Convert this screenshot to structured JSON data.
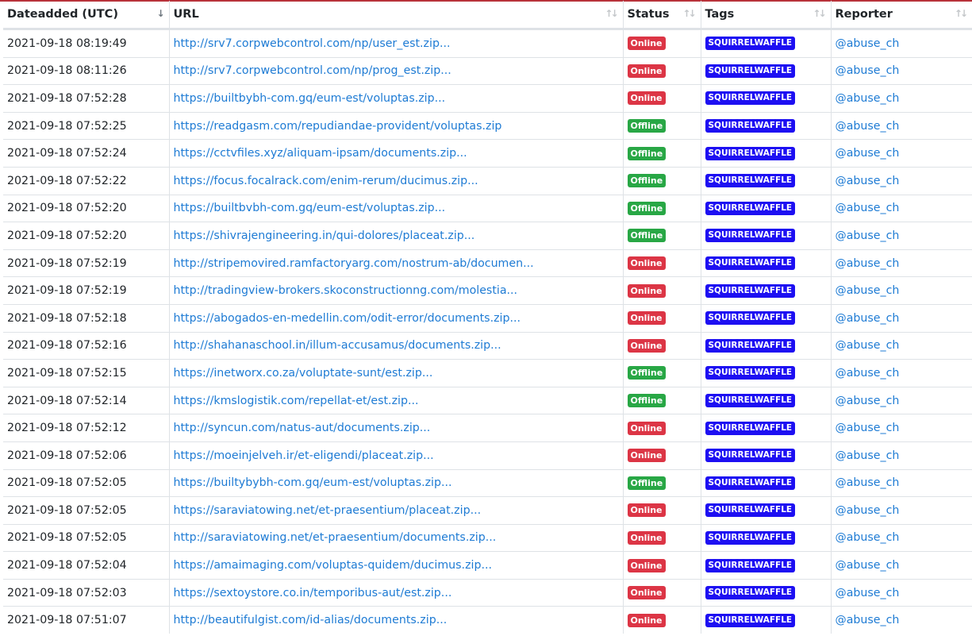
{
  "columns": {
    "date": "Dateadded (UTC)",
    "url": "URL",
    "status": "Status",
    "tags": "Tags",
    "reporter": "Reporter"
  },
  "colors": {
    "online": "#dc3545",
    "offline": "#28a745",
    "tag": "#1d0ff2",
    "link": "#1e7bd4"
  },
  "rows": [
    {
      "date": "2021-09-18 08:19:49",
      "url": "http://srv7.corpwebcontrol.com/np/user_est.zip...",
      "status": "Online",
      "tag": "SQUIRRELWAFFLE",
      "reporter": "@abuse_ch"
    },
    {
      "date": "2021-09-18 08:11:26",
      "url": "http://srv7.corpwebcontrol.com/np/prog_est.zip...",
      "status": "Online",
      "tag": "SQUIRRELWAFFLE",
      "reporter": "@abuse_ch"
    },
    {
      "date": "2021-09-18 07:52:28",
      "url": "https://builtbybh-com.gq/eum-est/voluptas.zip...",
      "status": "Online",
      "tag": "SQUIRRELWAFFLE",
      "reporter": "@abuse_ch"
    },
    {
      "date": "2021-09-18 07:52:25",
      "url": "https://readgasm.com/repudiandae-provident/voluptas.zip",
      "status": "Offline",
      "tag": "SQUIRRELWAFFLE",
      "reporter": "@abuse_ch"
    },
    {
      "date": "2021-09-18 07:52:24",
      "url": "https://cctvfiles.xyz/aliquam-ipsam/documents.zip...",
      "status": "Offline",
      "tag": "SQUIRRELWAFFLE",
      "reporter": "@abuse_ch"
    },
    {
      "date": "2021-09-18 07:52:22",
      "url": "https://focus.focalrack.com/enim-rerum/ducimus.zip...",
      "status": "Offline",
      "tag": "SQUIRRELWAFFLE",
      "reporter": "@abuse_ch"
    },
    {
      "date": "2021-09-18 07:52:20",
      "url": "https://builtbvbh-com.gq/eum-est/voluptas.zip...",
      "status": "Offline",
      "tag": "SQUIRRELWAFFLE",
      "reporter": "@abuse_ch"
    },
    {
      "date": "2021-09-18 07:52:20",
      "url": "https://shivrajengineering.in/qui-dolores/placeat.zip...",
      "status": "Offline",
      "tag": "SQUIRRELWAFFLE",
      "reporter": "@abuse_ch"
    },
    {
      "date": "2021-09-18 07:52:19",
      "url": "http://stripemovired.ramfactoryarg.com/nostrum-ab/documen...",
      "status": "Online",
      "tag": "SQUIRRELWAFFLE",
      "reporter": "@abuse_ch"
    },
    {
      "date": "2021-09-18 07:52:19",
      "url": "http://tradingview-brokers.skoconstructionng.com/molestia...",
      "status": "Online",
      "tag": "SQUIRRELWAFFLE",
      "reporter": "@abuse_ch"
    },
    {
      "date": "2021-09-18 07:52:18",
      "url": "https://abogados-en-medellin.com/odit-error/documents.zip...",
      "status": "Online",
      "tag": "SQUIRRELWAFFLE",
      "reporter": "@abuse_ch"
    },
    {
      "date": "2021-09-18 07:52:16",
      "url": "http://shahanaschool.in/illum-accusamus/documents.zip...",
      "status": "Online",
      "tag": "SQUIRRELWAFFLE",
      "reporter": "@abuse_ch"
    },
    {
      "date": "2021-09-18 07:52:15",
      "url": "https://inetworx.co.za/voluptate-sunt/est.zip...",
      "status": "Offline",
      "tag": "SQUIRRELWAFFLE",
      "reporter": "@abuse_ch"
    },
    {
      "date": "2021-09-18 07:52:14",
      "url": "https://kmslogistik.com/repellat-et/est.zip...",
      "status": "Offline",
      "tag": "SQUIRRELWAFFLE",
      "reporter": "@abuse_ch"
    },
    {
      "date": "2021-09-18 07:52:12",
      "url": "http://syncun.com/natus-aut/documents.zip...",
      "status": "Online",
      "tag": "SQUIRRELWAFFLE",
      "reporter": "@abuse_ch"
    },
    {
      "date": "2021-09-18 07:52:06",
      "url": "https://moeinjelveh.ir/et-eligendi/placeat.zip...",
      "status": "Online",
      "tag": "SQUIRRELWAFFLE",
      "reporter": "@abuse_ch"
    },
    {
      "date": "2021-09-18 07:52:05",
      "url": "https://builtybybh-com.gq/eum-est/voluptas.zip...",
      "status": "Offline",
      "tag": "SQUIRRELWAFFLE",
      "reporter": "@abuse_ch"
    },
    {
      "date": "2021-09-18 07:52:05",
      "url": "https://saraviatowing.net/et-praesentium/placeat.zip...",
      "status": "Online",
      "tag": "SQUIRRELWAFFLE",
      "reporter": "@abuse_ch"
    },
    {
      "date": "2021-09-18 07:52:05",
      "url": "http://saraviatowing.net/et-praesentium/documents.zip...",
      "status": "Online",
      "tag": "SQUIRRELWAFFLE",
      "reporter": "@abuse_ch"
    },
    {
      "date": "2021-09-18 07:52:04",
      "url": "https://amaimaging.com/voluptas-quidem/ducimus.zip...",
      "status": "Online",
      "tag": "SQUIRRELWAFFLE",
      "reporter": "@abuse_ch"
    },
    {
      "date": "2021-09-18 07:52:03",
      "url": "https://sextoystore.co.in/temporibus-aut/est.zip...",
      "status": "Online",
      "tag": "SQUIRRELWAFFLE",
      "reporter": "@abuse_ch"
    },
    {
      "date": "2021-09-18 07:51:07",
      "url": "http://beautifulgist.com/id-alias/documents.zip...",
      "status": "Online",
      "tag": "SQUIRRELWAFFLE",
      "reporter": "@abuse_ch"
    }
  ]
}
